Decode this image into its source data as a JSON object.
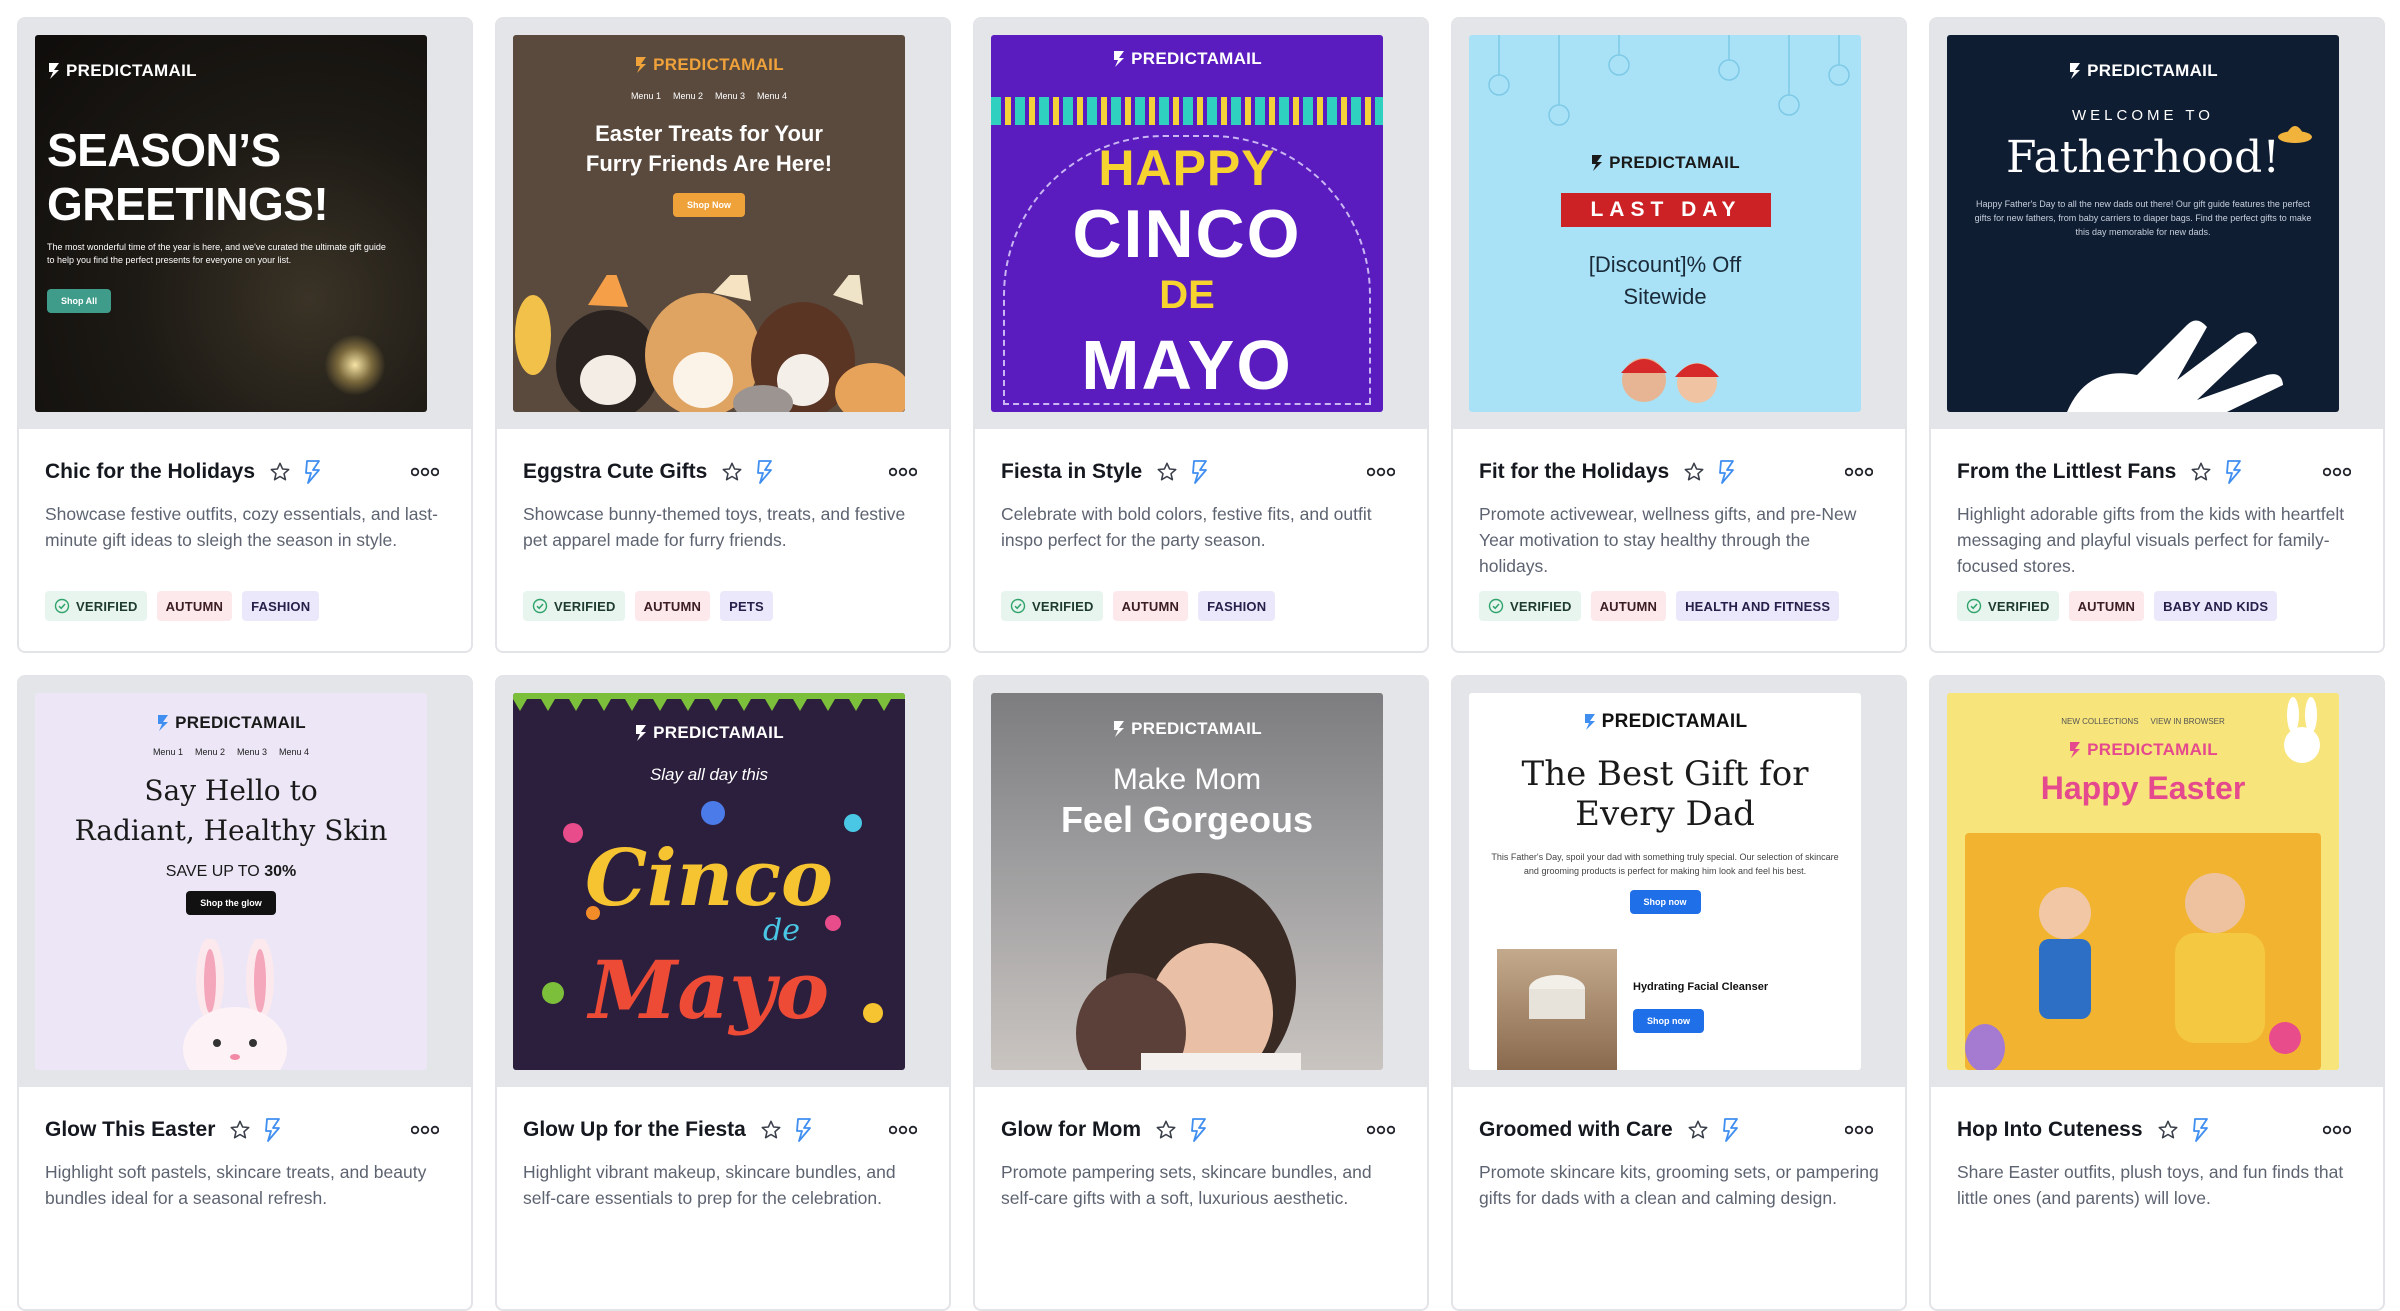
{
  "brand_name": "PREDICTAMAIL",
  "colors": {
    "verified_bg": "#e7f5ee",
    "season_bg": "#fde8eb",
    "category_bg": "#ebe8fb",
    "bolt": "#3f8ef0"
  },
  "cards": [
    {
      "title": "Chic for the Holidays",
      "description": "Showcase festive outfits, cozy essentials, and last-minute gift ideas to sleigh the season in style.",
      "tags": [
        "VERIFIED",
        "AUTUMN",
        "FASHION"
      ],
      "thumb": {
        "headline1": "SEASON’S",
        "headline2": "GREETINGS!",
        "body": "The most wonderful time of the year is here, and we've curated the ultimate gift guide to help you find the perfect presents for everyone on your list.",
        "button": "Shop All"
      }
    },
    {
      "title": "Eggstra Cute Gifts",
      "description": "Showcase bunny-themed toys, treats, and festive pet apparel made for furry friends.",
      "tags": [
        "VERIFIED",
        "AUTUMN",
        "PETS"
      ],
      "thumb": {
        "menu": [
          "Menu 1",
          "Menu 2",
          "Menu 3",
          "Menu 4"
        ],
        "headline1": "Easter Treats for Your",
        "headline2": "Furry Friends Are Here!",
        "button": "Shop Now"
      }
    },
    {
      "title": "Fiesta in Style",
      "description": "Celebrate with bold colors, festive fits, and outfit inspo perfect for the party season.",
      "tags": [
        "VERIFIED",
        "AUTUMN",
        "FASHION"
      ],
      "thumb": {
        "line1": "HAPPY",
        "line2": "CINCO",
        "line3": "DE",
        "line4": "MAYO"
      }
    },
    {
      "title": "Fit for the Holidays",
      "description": "Promote activewear, wellness gifts, and pre-New Year motivation to stay healthy through the holidays.",
      "tags": [
        "VERIFIED",
        "AUTUMN",
        "HEALTH AND FITNESS"
      ],
      "thumb": {
        "banner": "LAST DAY",
        "headline1": "[Discount]% Off",
        "headline2": "Sitewide"
      }
    },
    {
      "title": "From the Littlest Fans",
      "description": "Highlight adorable gifts from the kids with heartfelt messaging and playful visuals perfect for family-focused stores.",
      "tags": [
        "VERIFIED",
        "AUTUMN",
        "BABY AND KIDS"
      ],
      "thumb": {
        "kicker": "WELCOME TO",
        "headline": "Fatherhood!",
        "body": "Happy Father's Day to all the new dads out there! Our gift guide features the perfect gifts for new fathers, from baby carriers to diaper bags. Find the perfect gifts to make this day memorable for new dads."
      }
    },
    {
      "title": "Glow This Easter",
      "description": "Highlight soft pastels, skincare treats, and beauty bundles ideal for a seasonal refresh.",
      "tags": [],
      "thumb": {
        "menu": [
          "Menu 1",
          "Menu 2",
          "Menu 3",
          "Menu 4"
        ],
        "headline1": "Say Hello to",
        "headline2": "Radiant, Healthy Skin",
        "save_prefix": "SAVE UP TO ",
        "save_value": "30%",
        "button": "Shop the glow"
      }
    },
    {
      "title": "Glow Up for the Fiesta",
      "description": "Highlight vibrant makeup, skincare bundles, and self-care essentials to prep for the celebration.",
      "tags": [],
      "thumb": {
        "kicker": "Slay all day this",
        "line1": "Cinco",
        "line2": "de",
        "line3": "Mayo"
      }
    },
    {
      "title": "Glow for Mom",
      "description": "Promote pampering sets, skincare bundles, and self-care gifts with a soft, luxurious aesthetic.",
      "tags": [],
      "thumb": {
        "headline1": "Make Mom",
        "headline2": "Feel Gorgeous"
      }
    },
    {
      "title": "Groomed with Care",
      "description": "Promote skincare kits, grooming sets, or pampering gifts for dads with a clean and calming design.",
      "tags": [],
      "thumb": {
        "headline1": "The Best Gift for",
        "headline2": "Every Dad",
        "body": "This Father's Day, spoil your dad with something truly special. Our selection of skincare and grooming products is perfect for making him look and feel his best.",
        "button": "Shop now",
        "product": "Hydrating Facial Cleanser",
        "product_button": "Shop now"
      }
    },
    {
      "title": "Hop Into Cuteness",
      "description": "Share Easter outfits, plush toys, and fun finds that little ones (and parents) will love.",
      "tags": [],
      "thumb": {
        "nav": [
          "NEW COLLECTIONS",
          "VIEW IN BROWSER"
        ],
        "headline": "Happy Easter"
      }
    }
  ]
}
